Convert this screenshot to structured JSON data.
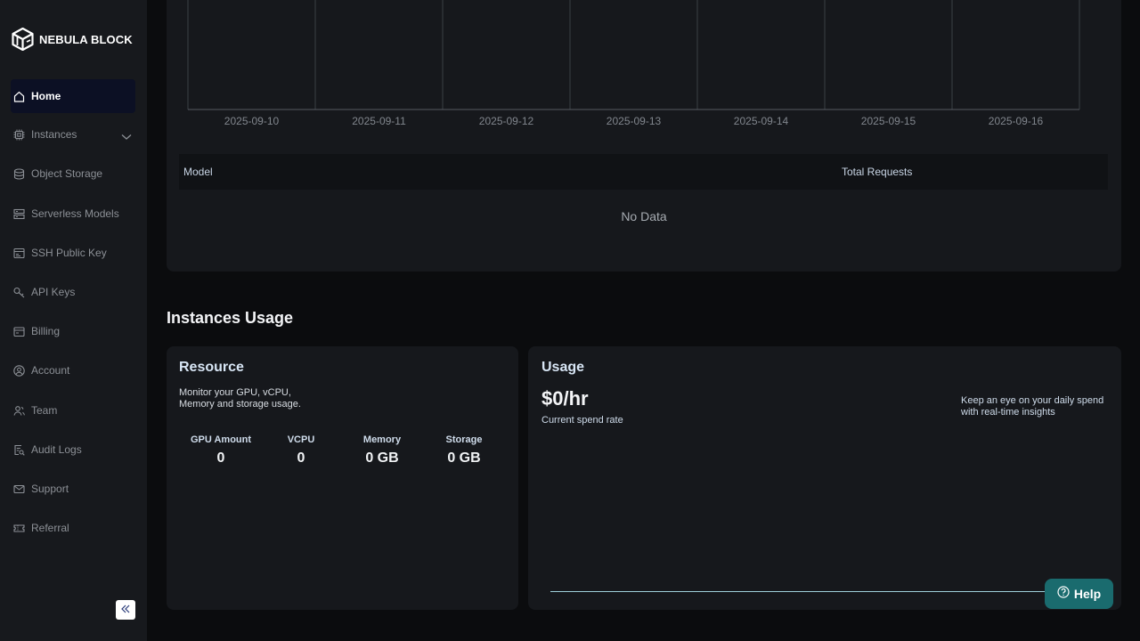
{
  "brand": {
    "name": "NEBULA BLOCK"
  },
  "sidebar": {
    "items": [
      {
        "label": "Home",
        "icon": "home-icon",
        "active": true
      },
      {
        "label": "Instances",
        "icon": "chip-icon",
        "expandable": true
      },
      {
        "label": "Object Storage",
        "icon": "database-icon"
      },
      {
        "label": "Serverless Models",
        "icon": "server-icon"
      },
      {
        "label": "SSH Public Key",
        "icon": "ssh-key-icon"
      },
      {
        "label": "API Keys",
        "icon": "key-icon"
      },
      {
        "label": "Billing",
        "icon": "billing-icon"
      },
      {
        "label": "Account",
        "icon": "account-icon"
      },
      {
        "label": "Team",
        "icon": "team-icon"
      },
      {
        "label": "Audit Logs",
        "icon": "audit-log-icon"
      },
      {
        "label": "Support",
        "icon": "mail-icon"
      },
      {
        "label": "Referral",
        "icon": "ticket-icon"
      }
    ]
  },
  "chart_data": {
    "type": "bar",
    "categories": [
      "2025-09-10",
      "2025-09-11",
      "2025-09-12",
      "2025-09-13",
      "2025-09-14",
      "2025-09-15",
      "2025-09-16"
    ],
    "series": [],
    "title": "",
    "xlabel": "",
    "ylabel": "",
    "grid": "vertical"
  },
  "model_table": {
    "columns": [
      "Model",
      "Total Requests"
    ],
    "empty_text": "No Data"
  },
  "instances_usage": {
    "section_title": "Instances Usage",
    "resource": {
      "title": "Resource",
      "description": "Monitor your GPU, vCPU, Memory and storage usage.",
      "stats": [
        {
          "label": "GPU Amount",
          "value": "0"
        },
        {
          "label": "VCPU",
          "value": "0"
        },
        {
          "label": "Memory",
          "value": "0 GB"
        },
        {
          "label": "Storage",
          "value": "0 GB"
        }
      ]
    },
    "usage": {
      "title": "Usage",
      "amount": "$0/hr",
      "subtitle": "Current spend rate",
      "note": "Keep an eye on your daily spend with real-time insights"
    }
  },
  "help": {
    "label": "Help"
  },
  "colors": {
    "accent": "#1a6b6e",
    "active_nav": "#0c1024",
    "card": "#16181c",
    "sidebar": "#17191d"
  }
}
